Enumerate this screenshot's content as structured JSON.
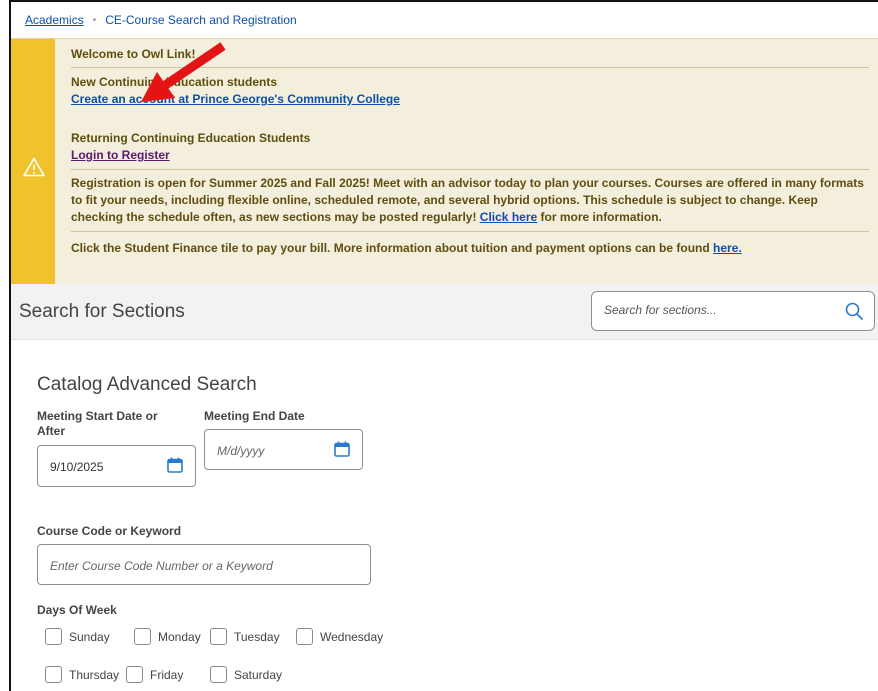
{
  "breadcrumb": {
    "root": "Academics",
    "separator": "•",
    "current": "CE-Course Search and Registration"
  },
  "notice": {
    "welcome": "Welcome to Owl Link!",
    "new_students_heading": "New Continuing Education students",
    "create_account_link": "Create an account at Prince George's Community College",
    "returning_heading": "Returning Continuing Education Students",
    "login_link": "Login to Register",
    "registration_text": "Registration is open for Summer 2025 and Fall 2025! Meet with an advisor today to plan your courses. Courses are offered in many formats to fit your needs, including flexible online, scheduled remote, and several hybrid options. This schedule is subject to change. Keep checking the schedule often, as new sections may be posted regularly!",
    "click_here_link": "Click here",
    "click_here_suffix": "for more information.",
    "finance_text": "Click the Student Finance tile to pay your bill. More information about tuition and payment options can be found",
    "here_link": "here.",
    "icon": "warning-icon",
    "colors": {
      "accent_bar": "#f0c22c",
      "background": "#f4eedc",
      "text": "#5d4f10",
      "link": "#0d50a8"
    }
  },
  "search": {
    "title": "Search for Sections",
    "placeholder": "Search for sections...",
    "icon": "search-icon"
  },
  "advanced": {
    "title": "Catalog Advanced Search",
    "start_date_label": "Meeting Start Date or After",
    "start_date_value": "9/10/2025",
    "end_date_label": "Meeting End Date",
    "end_date_placeholder": "M/d/yyyy",
    "keyword_label": "Course Code or Keyword",
    "keyword_placeholder": "Enter Course Code Number or a Keyword",
    "days_label": "Days Of Week",
    "days": [
      "Sunday",
      "Monday",
      "Tuesday",
      "Wednesday",
      "Thursday",
      "Friday",
      "Saturday"
    ]
  }
}
